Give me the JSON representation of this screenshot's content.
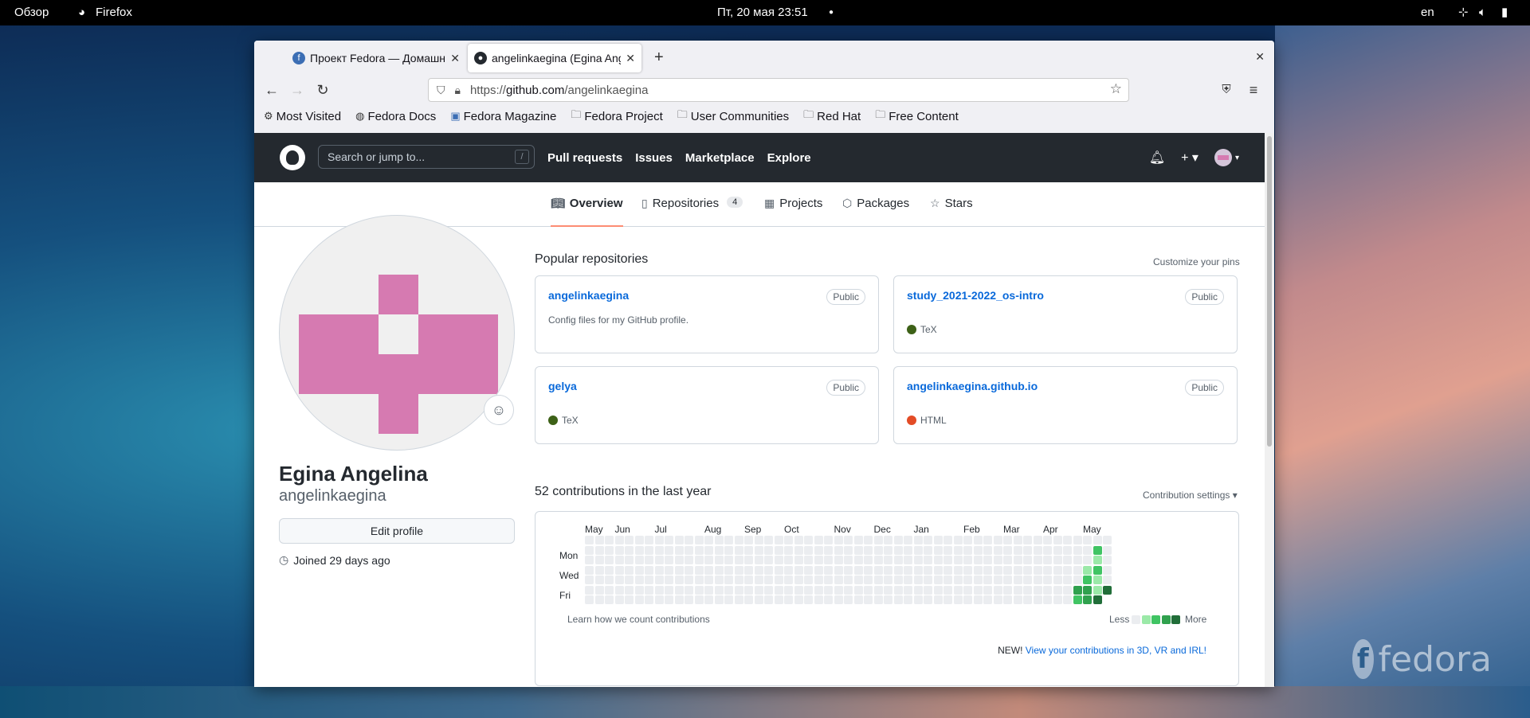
{
  "topbar": {
    "activities": "Обзор",
    "app": "Firefox",
    "clock": "Пт, 20 мая  23:51",
    "lang": "en"
  },
  "desktop": {
    "brand": "fedora"
  },
  "browser": {
    "tabs": [
      {
        "title": "Проект Fedora — Домашняя",
        "active": false
      },
      {
        "title": "angelinkaegina (Egina Angelina)",
        "active": true
      }
    ],
    "url_scheme": "https://",
    "url_host": "github.com",
    "url_path": "/angelinkaegina",
    "bookmarks": [
      "Most Visited",
      "Fedora Docs",
      "Fedora Magazine",
      "Fedora Project",
      "User Communities",
      "Red Hat",
      "Free Content"
    ]
  },
  "github": {
    "search_placeholder": "Search or jump to...",
    "search_key": "/",
    "nav": [
      "Pull requests",
      "Issues",
      "Marketplace",
      "Explore"
    ],
    "tabs": {
      "overview": "Overview",
      "repositories": "Repositories",
      "repo_count": "4",
      "projects": "Projects",
      "packages": "Packages",
      "stars": "Stars"
    },
    "profile": {
      "name": "Egina Angelina",
      "login": "angelinkaegina",
      "edit": "Edit profile",
      "joined": "Joined 29 days ago"
    },
    "popular": {
      "title": "Popular repositories",
      "customize": "Customize your pins",
      "repos": [
        {
          "name": "angelinkaegina",
          "visibility": "Public",
          "description": "Config files for my GitHub profile.",
          "language": "",
          "lang_color": ""
        },
        {
          "name": "study_2021-2022_os-intro",
          "visibility": "Public",
          "description": "",
          "language": "TeX",
          "lang_color": "#3D6117"
        },
        {
          "name": "gelya",
          "visibility": "Public",
          "description": "",
          "language": "TeX",
          "lang_color": "#3D6117"
        },
        {
          "name": "angelinkaegina.github.io",
          "visibility": "Public",
          "description": "",
          "language": "HTML",
          "lang_color": "#e34c26"
        }
      ]
    },
    "contributions": {
      "title": "52 contributions in the last year",
      "settings": "Contribution settings ▾",
      "months": [
        "May",
        "Jun",
        "Jul",
        "Aug",
        "Sep",
        "Oct",
        "Nov",
        "Dec",
        "Jan",
        "Feb",
        "Mar",
        "Apr",
        "May"
      ],
      "days": [
        "Mon",
        "Wed",
        "Fri"
      ],
      "learn": "Learn how we count contributions",
      "less": "Less",
      "more": "More",
      "new_label": "NEW!",
      "new_link": "View your contributions in 3D, VR and IRL!",
      "colors": [
        "#ebedf0",
        "#9be9a8",
        "#40c463",
        "#30a14e",
        "#216e39"
      ],
      "active_cells": [
        {
          "week": 49,
          "day": 5,
          "level": 3
        },
        {
          "week": 49,
          "day": 6,
          "level": 2
        },
        {
          "week": 50,
          "day": 3,
          "level": 1
        },
        {
          "week": 50,
          "day": 4,
          "level": 2
        },
        {
          "week": 50,
          "day": 5,
          "level": 3
        },
        {
          "week": 50,
          "day": 6,
          "level": 3
        },
        {
          "week": 51,
          "day": 1,
          "level": 2
        },
        {
          "week": 51,
          "day": 2,
          "level": 1
        },
        {
          "week": 51,
          "day": 3,
          "level": 2
        },
        {
          "week": 51,
          "day": 4,
          "level": 1
        },
        {
          "week": 51,
          "day": 5,
          "level": 1
        },
        {
          "week": 51,
          "day": 6,
          "level": 4
        },
        {
          "week": 52,
          "day": 5,
          "level": 4
        },
        {
          "week": 53,
          "day": 5,
          "level": 3
        }
      ]
    }
  }
}
